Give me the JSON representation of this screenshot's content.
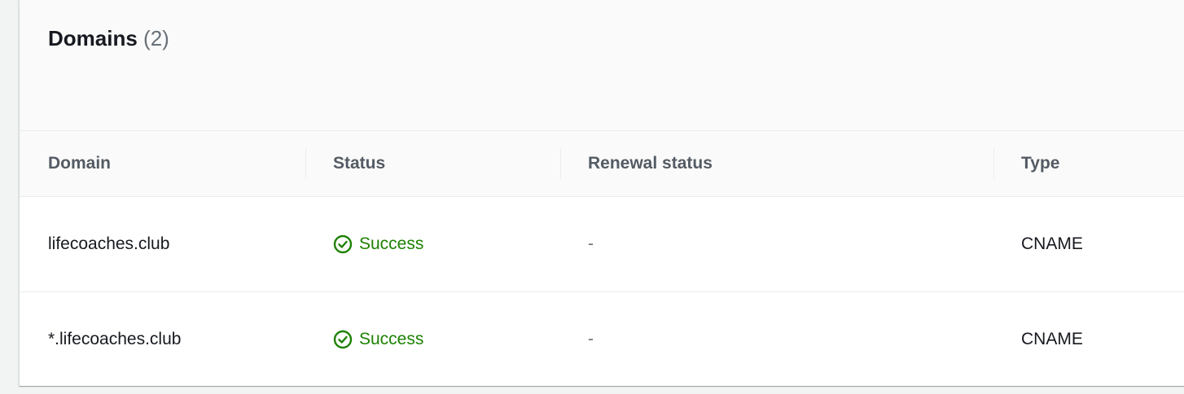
{
  "panel": {
    "title": "Domains",
    "count": "(2)"
  },
  "table": {
    "columns": [
      "Domain",
      "Status",
      "Renewal status",
      "Type"
    ],
    "rows": [
      {
        "domain": "lifecoaches.club",
        "status": "Success",
        "renewal_status": "-",
        "type": "CNAME"
      },
      {
        "domain": "*.lifecoaches.club",
        "status": "Success",
        "renewal_status": "-",
        "type": "CNAME"
      }
    ]
  },
  "icons": {
    "status": "check-circle-icon"
  },
  "colors": {
    "success": "#1d8102",
    "header_text": "#545b64",
    "muted": "#687078"
  }
}
